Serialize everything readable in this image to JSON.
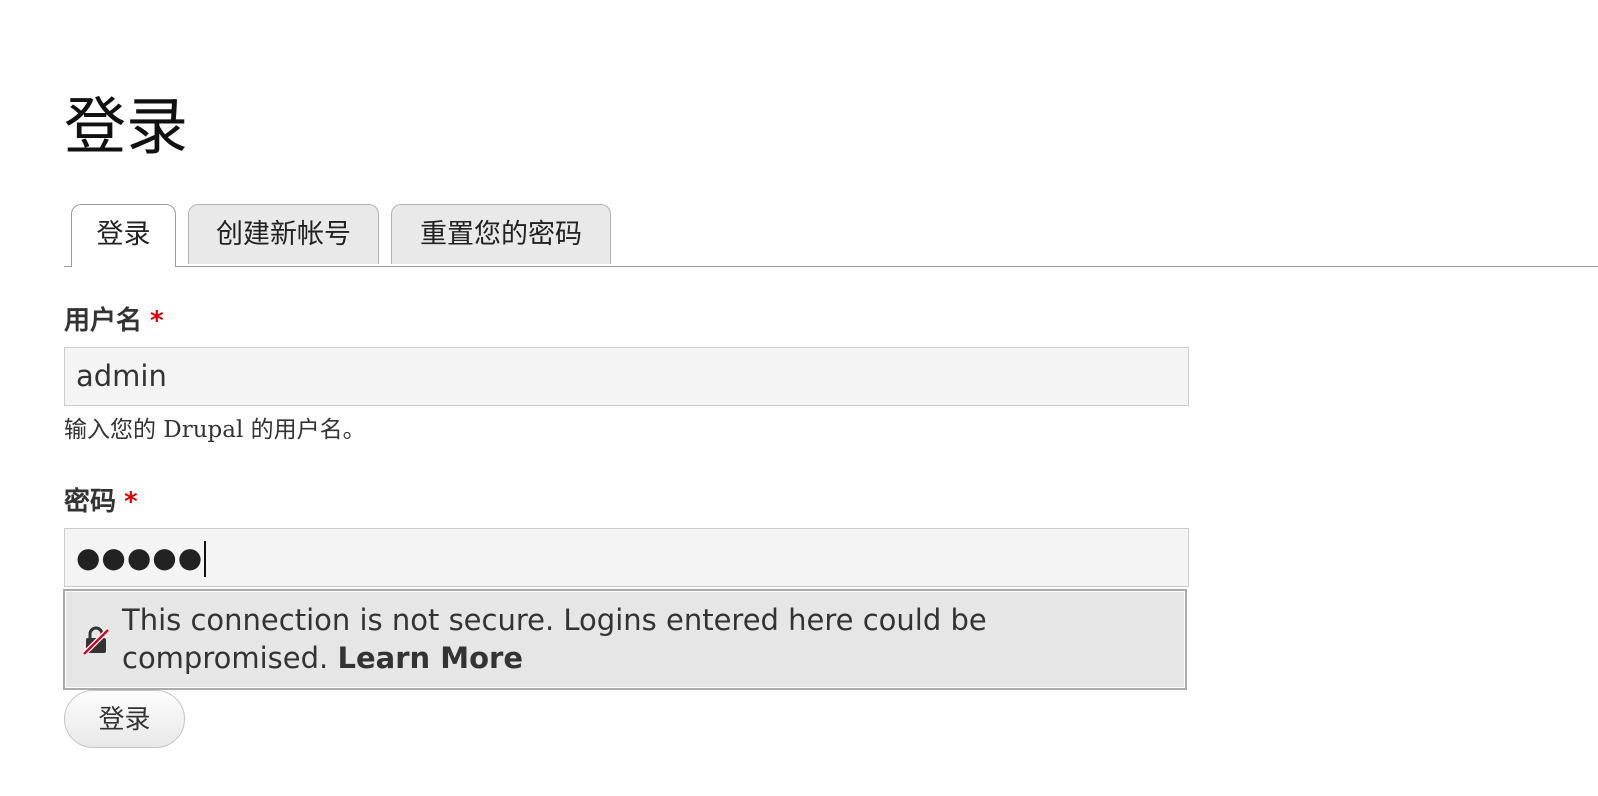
{
  "page": {
    "title": "登录"
  },
  "tabs": [
    {
      "label": "登录",
      "active": true
    },
    {
      "label": "创建新帐号",
      "active": false
    },
    {
      "label": "重置您的密码",
      "active": false
    }
  ],
  "form": {
    "username": {
      "label": "用户名",
      "required_mark": "*",
      "value": "admin",
      "description": "输入您的 Drupal 的用户名。"
    },
    "password": {
      "label": "密码",
      "required_mark": "*",
      "masked_value": "●●●●●"
    },
    "insecure_warning": {
      "icon": "insecure-lock-icon",
      "message": "This connection is not secure. Logins entered here could be compromised.",
      "link_label": "Learn More"
    },
    "submit_label": "登录"
  },
  "colors": {
    "required": "#e00000",
    "input_background": "#f4f4f4",
    "warning_background": "#e6e6e6",
    "tab_inactive": "#e9e9e9"
  }
}
